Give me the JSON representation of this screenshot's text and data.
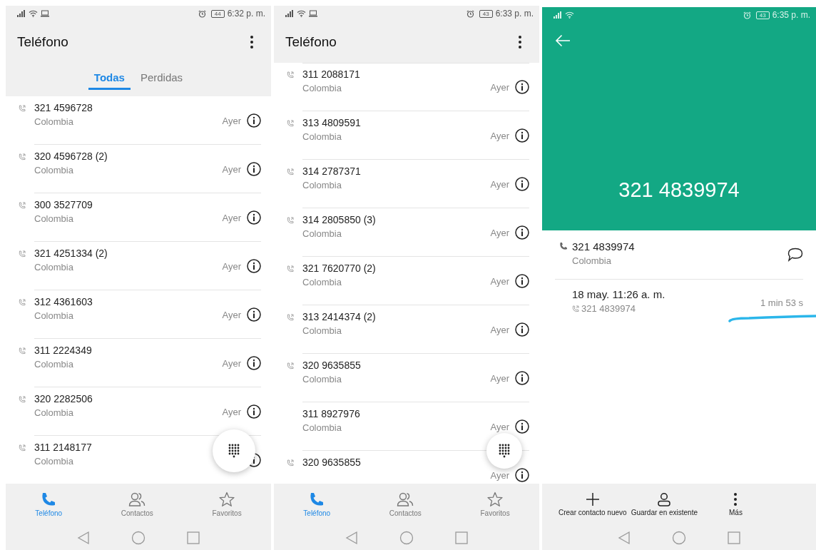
{
  "screens": [
    {
      "kind": "call_log",
      "status": {
        "screen_notification": true,
        "battery": "44",
        "time": "6:32 p. m."
      },
      "title": "Teléfono",
      "tabs": [
        {
          "label": "Todas",
          "selected": true
        },
        {
          "label": "Perdidas",
          "selected": false
        }
      ],
      "calls": [
        {
          "number": "321 4596728",
          "location": "Colombia",
          "date": "Ayer",
          "call_icon": true
        },
        {
          "number": "320 4596728 (2)",
          "location": "Colombia",
          "date": "Ayer",
          "call_icon": true
        },
        {
          "number": "300 3527709",
          "location": "Colombia",
          "date": "Ayer",
          "call_icon": true
        },
        {
          "number": "321 4251334 (2)",
          "location": "Colombia",
          "date": "Ayer",
          "call_icon": true
        },
        {
          "number": "312 4361603",
          "location": "Colombia",
          "date": "Ayer",
          "call_icon": true
        },
        {
          "number": "311 2224349",
          "location": "Colombia",
          "date": "Ayer",
          "call_icon": true
        },
        {
          "number": "320 2282506",
          "location": "Colombia",
          "date": "Ayer",
          "call_icon": true
        },
        {
          "number": "311 2148177",
          "location": "Colombia",
          "call_icon": true
        }
      ],
      "nav": [
        {
          "kind": "phone",
          "label": "Teléfono",
          "selected": true
        },
        {
          "kind": "contacts",
          "label": "Contactos",
          "selected": false
        },
        {
          "kind": "star",
          "label": "Favoritos",
          "selected": false
        }
      ]
    },
    {
      "kind": "call_log",
      "status": {
        "screen_notification": true,
        "battery": "43",
        "time": "6:33 p. m."
      },
      "title": "Teléfono",
      "calls": [
        {
          "number": "311 2088171",
          "location": "Colombia",
          "date": "Ayer",
          "call_icon": true
        },
        {
          "number": "313 4809591",
          "location": "Colombia",
          "date": "Ayer",
          "call_icon": true
        },
        {
          "number": "314 2787371",
          "location": "Colombia",
          "date": "Ayer",
          "call_icon": true
        },
        {
          "number": "314 2805850 (3)",
          "location": "Colombia",
          "date": "Ayer",
          "call_icon": true
        },
        {
          "number": "321 7620770 (2)",
          "location": "Colombia",
          "date": "Ayer",
          "call_icon": true
        },
        {
          "number": "313 2414374 (2)",
          "location": "Colombia",
          "date": "Ayer",
          "call_icon": true
        },
        {
          "number": "320 9635855",
          "location": "Colombia",
          "date": "Ayer",
          "call_icon": true
        },
        {
          "number": "311 8927976",
          "location": "Colombia",
          "date": "Ayer",
          "call_icon": false
        },
        {
          "number": "320 9635855",
          "date": "Ayer",
          "call_icon": true
        }
      ],
      "nav": [
        {
          "kind": "phone",
          "label": "Teléfono",
          "selected": true
        },
        {
          "kind": "contacts",
          "label": "Contactos",
          "selected": false
        },
        {
          "kind": "star",
          "label": "Favoritos",
          "selected": false
        }
      ]
    },
    {
      "kind": "call_detail",
      "status": {
        "screen_notification": false,
        "battery": "43",
        "time": "6:35 p. m."
      },
      "number": "321 4839974",
      "contact": {
        "number": "321 4839974",
        "location": "Colombia"
      },
      "history": [
        {
          "datetime": "18 may. 11:26 a. m.",
          "number": "321 4839974",
          "duration": "1 min 53 s"
        }
      ],
      "actions": [
        {
          "kind": "plus",
          "label": "Crear contacto nuevo"
        },
        {
          "kind": "person",
          "label": "Guardar en existente"
        },
        {
          "kind": "more",
          "label": "Más"
        }
      ]
    }
  ]
}
